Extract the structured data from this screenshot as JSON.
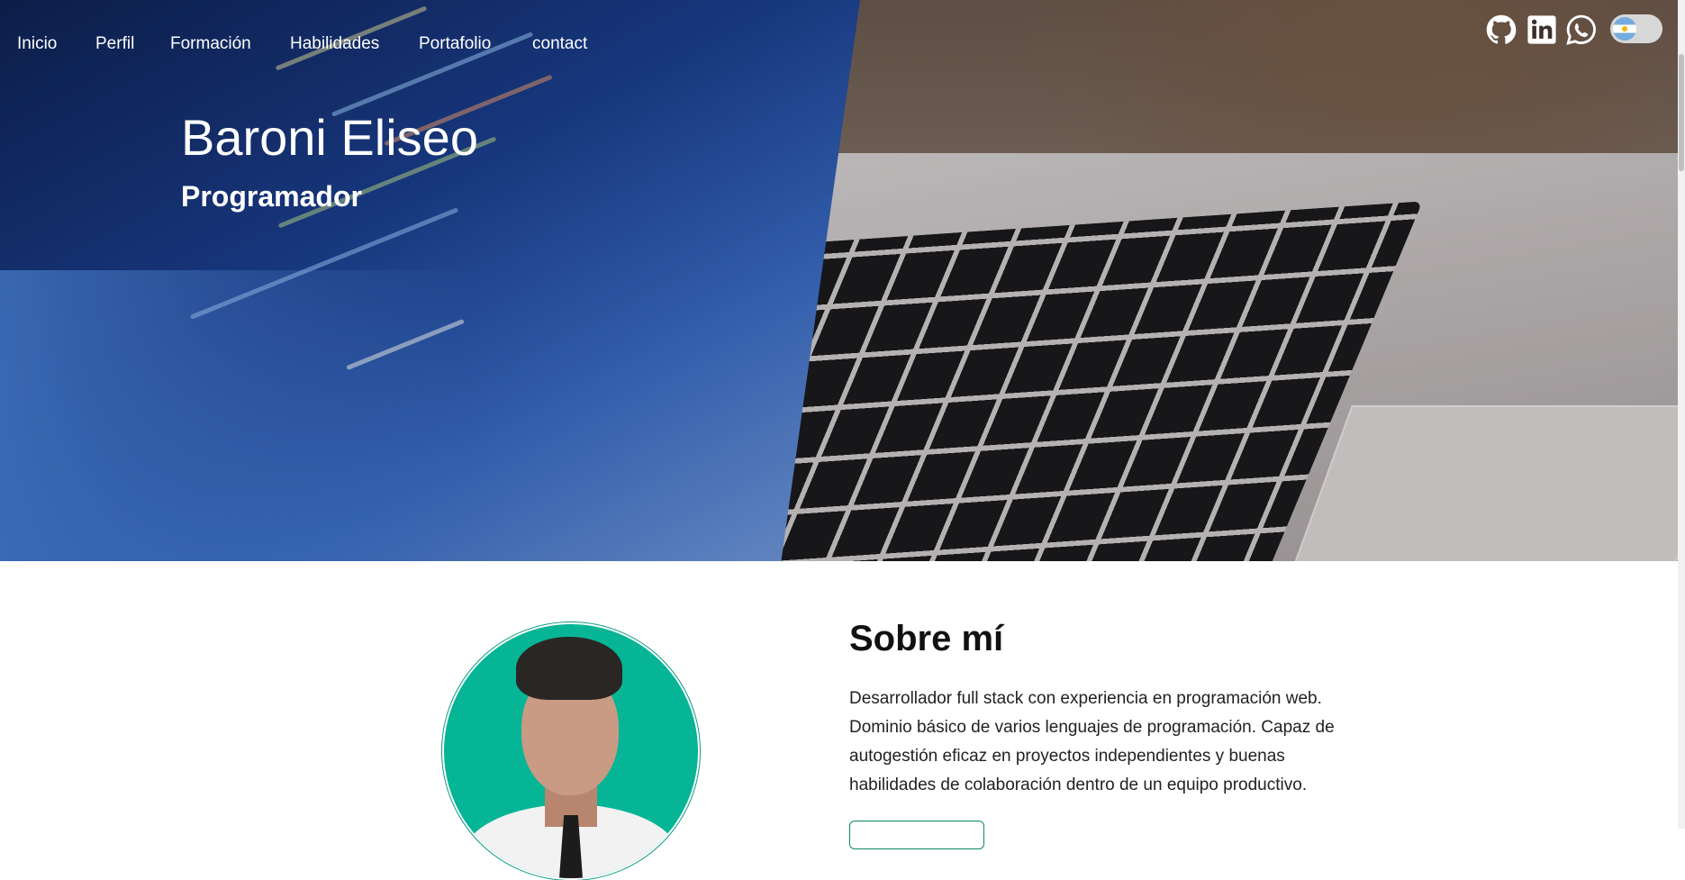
{
  "nav": {
    "links": [
      "Inicio",
      "Perfil",
      "Formación",
      "Habilidades",
      "Portafolio",
      "contact"
    ]
  },
  "social": {
    "icons": [
      "github-icon",
      "linkedin-icon",
      "whatsapp-icon"
    ]
  },
  "language_toggle": {
    "flag": "argentina-flag-icon"
  },
  "hero": {
    "name": "Baroni Eliseo",
    "role": "Programador"
  },
  "about": {
    "title": "Sobre mí",
    "text": "Desarrollador full stack con experiencia en programación web. Dominio básico de varios lenguajes de programación. Capaz de autogestión eficaz en proyectos independientes y buenas habilidades de colaboración dentro de un equipo productivo."
  },
  "colors": {
    "accent": "#06b596",
    "button_border": "#0a8a5a"
  }
}
